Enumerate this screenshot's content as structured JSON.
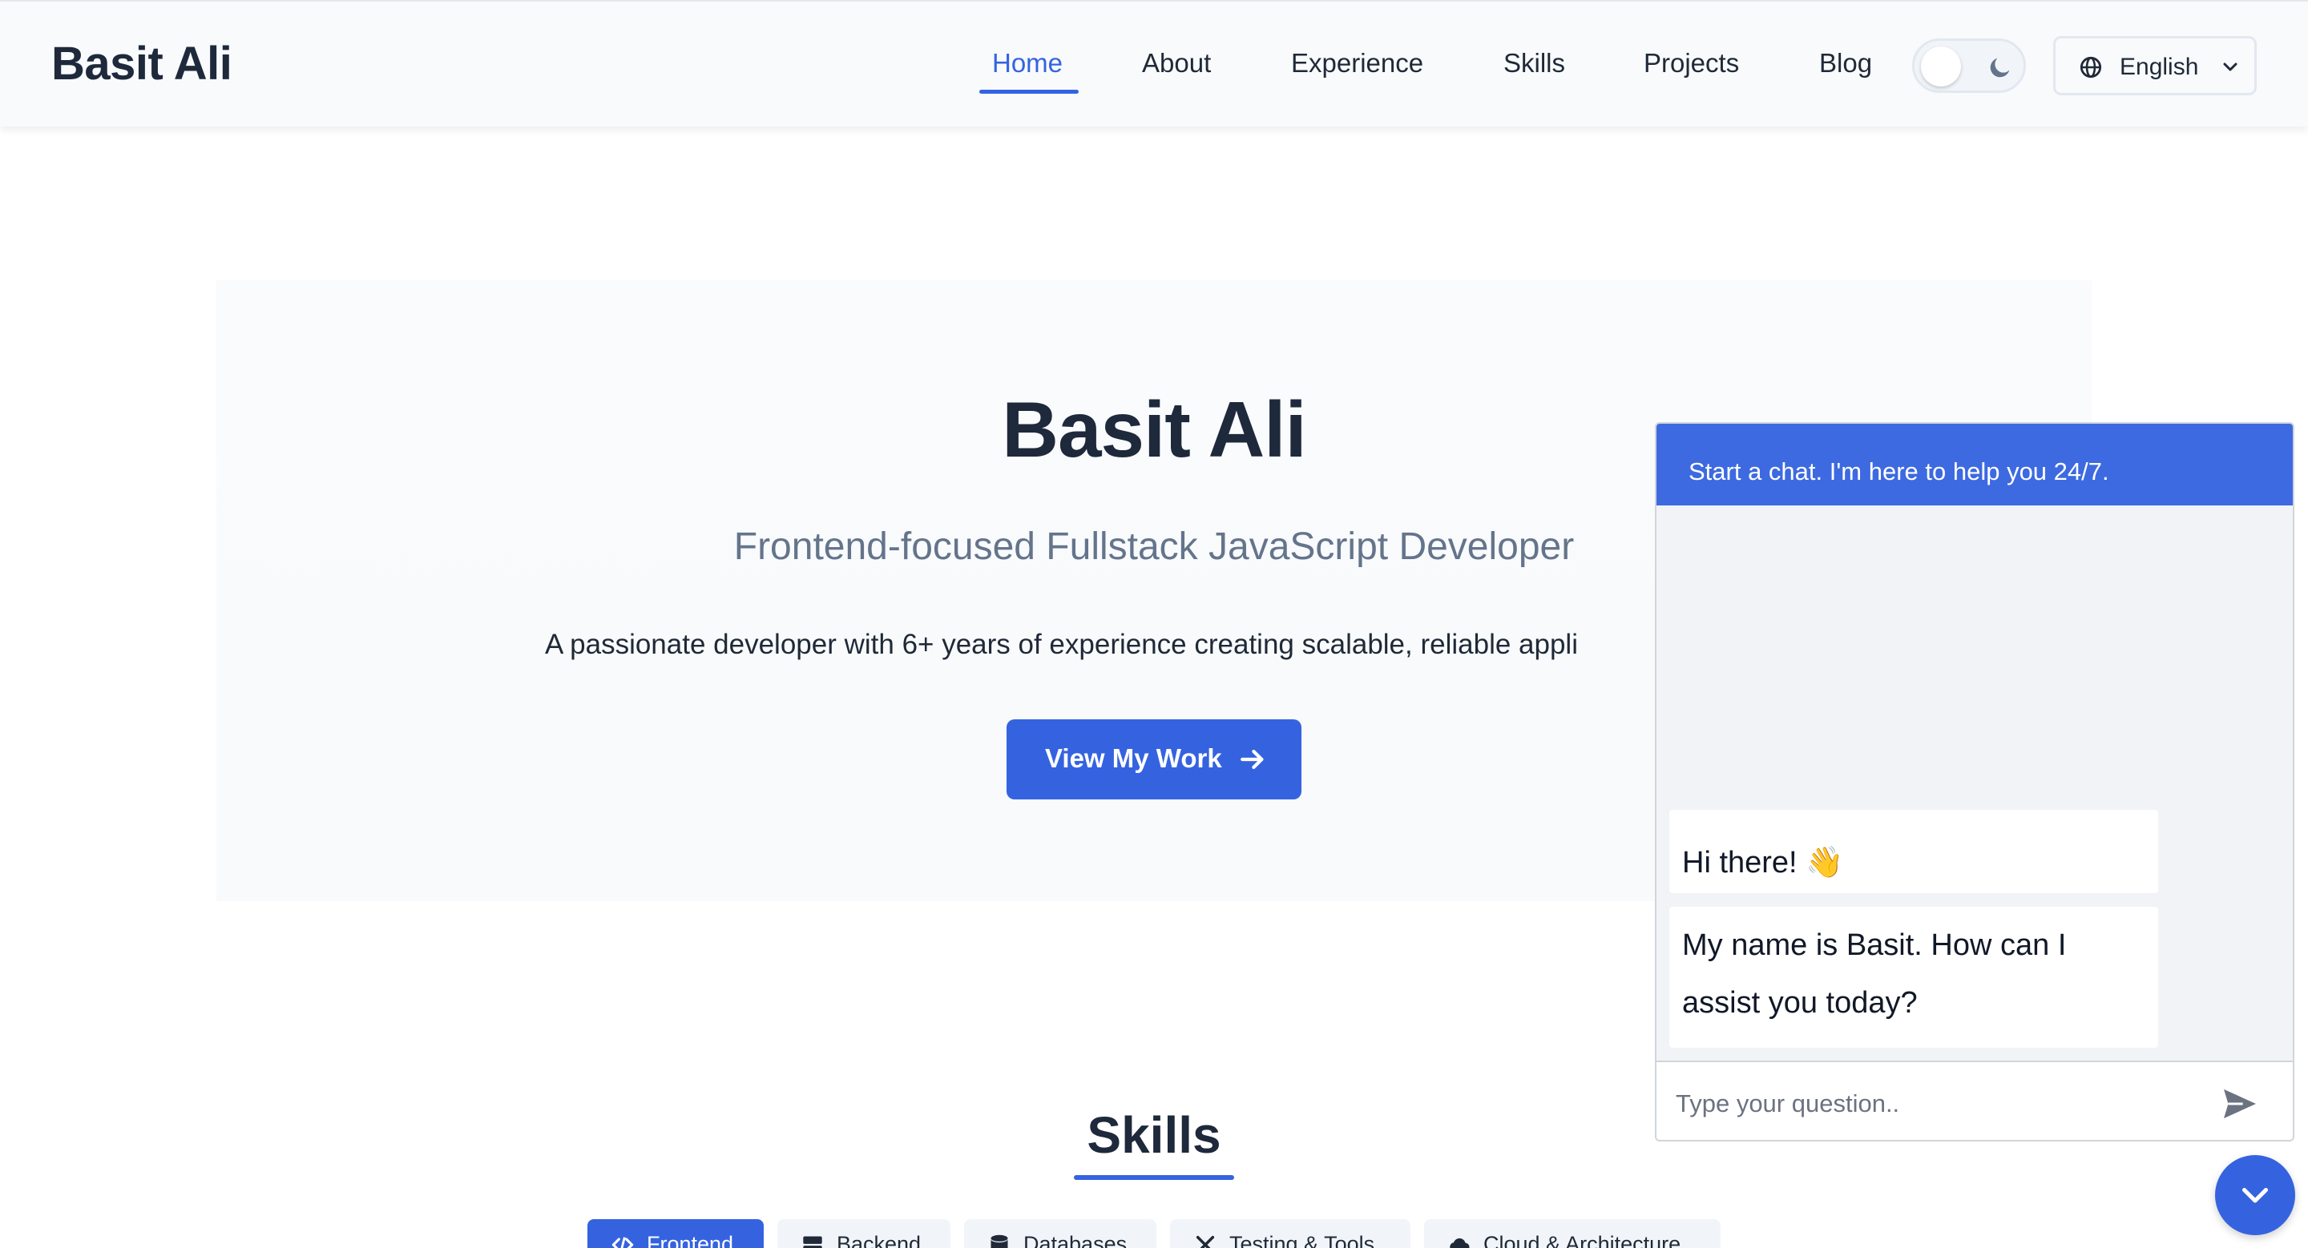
{
  "brand": "Basit Ali",
  "nav": {
    "links": [
      "Home",
      "About",
      "Experience",
      "Skills",
      "Projects",
      "Blog"
    ],
    "active": "Home"
  },
  "theme_toggle": {
    "icon": "moon-icon"
  },
  "language": {
    "selected": "English",
    "icon": "globe-icon"
  },
  "hero": {
    "title": "Basit Ali",
    "subtitle": "Frontend-focused Fullstack JavaScript Developer",
    "description": "A passionate developer with 6+ years of experience creating scalable, reliable appli",
    "cta_label": "View My Work"
  },
  "skills": {
    "title": "Skills",
    "tabs": [
      "Frontend",
      "Backend",
      "Databases",
      "Testing & Tools",
      "Cloud & Architecture"
    ],
    "active_tab": "Frontend"
  },
  "chat": {
    "header": "Start a chat. I'm here to help you 24/7.",
    "messages": [
      "Hi there! 👋",
      "My name is Basit. How can I assist you today?"
    ],
    "input_placeholder": "Type your question.."
  },
  "colors": {
    "accent": "#3563e0",
    "text": "#1e293b",
    "muted": "#64748b",
    "chat_header": "#3d6ae0"
  }
}
